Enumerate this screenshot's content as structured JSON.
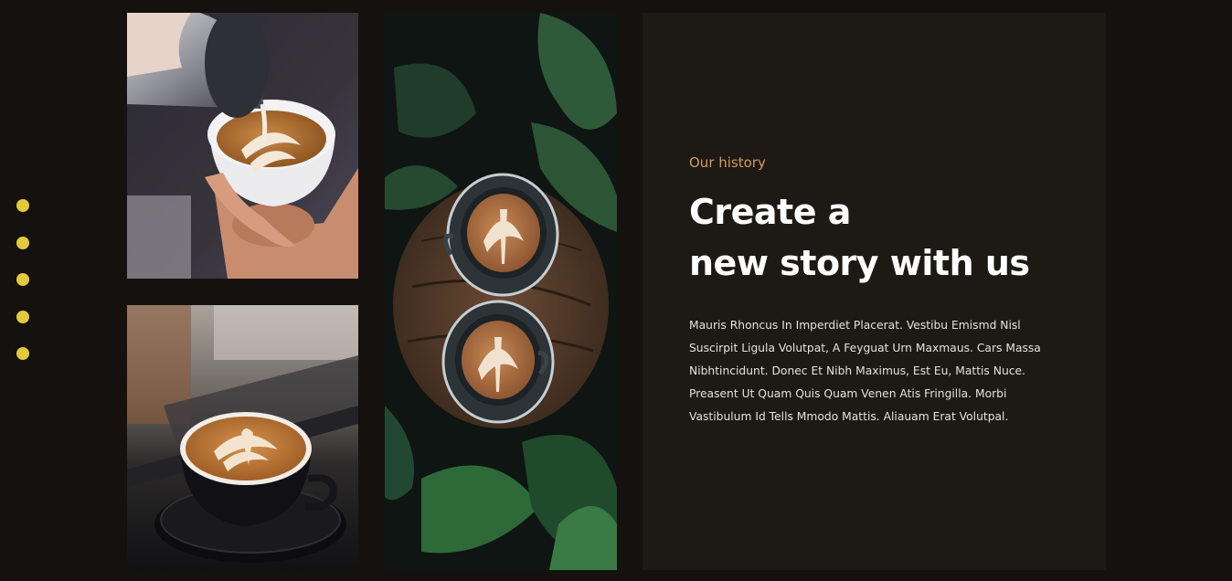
{
  "carousel": {
    "indicator_count": 5
  },
  "gallery": [
    {
      "alt": "Barista pouring latte art into a white cup"
    },
    {
      "alt": "Latte in a black cup on a saucer"
    },
    {
      "alt": "Two lattes on a wooden table among plants"
    }
  ],
  "history": {
    "eyebrow": "Our history",
    "headline_line1": "Create a",
    "headline_line2": "new story with us",
    "body": "Mauris Rhoncus In Imperdiet Placerat. Vestibu Emismd Nisl Suscirpit Ligula Volutpat, A Feyguat Urn Maxmaus. Cars Massa Nibhtincidunt. Donec Et Nibh Maximus, Est Eu, Mattis Nuce. Preasent Ut Quam Quis Quam Venen Atis Fringilla. Morbi Vastibulum Id Tells Mmodo Mattis. Aliauam Erat Volutpal."
  },
  "colors": {
    "background": "#15110e",
    "panel": "#1d1915",
    "accent_dot": "#e3c93b",
    "eyebrow": "#d49a5b"
  }
}
